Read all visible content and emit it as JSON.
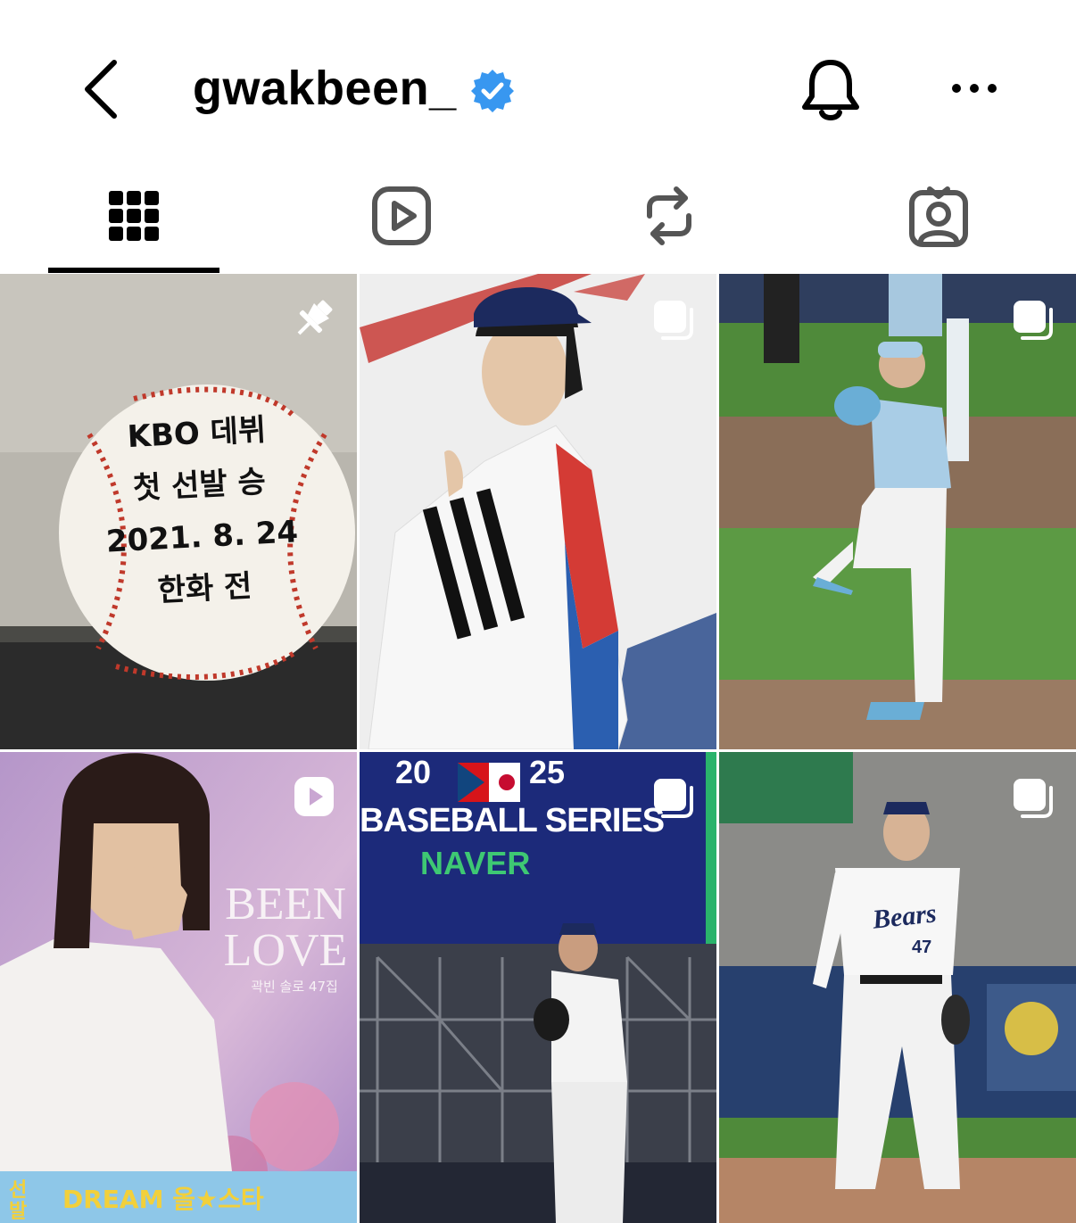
{
  "header": {
    "username": "gwakbeen_",
    "icons": [
      "back-chevron-icon",
      "verified-badge-icon",
      "bell-icon",
      "more-icon"
    ]
  },
  "tabs": [
    {
      "name": "posts-grid-icon",
      "active": true
    },
    {
      "name": "reels-icon",
      "active": false
    },
    {
      "name": "reposts-icon",
      "active": false
    },
    {
      "name": "tagged-icon",
      "active": false
    }
  ],
  "posts": [
    {
      "badge": "pin-icon",
      "ball_lines": [
        "KBO 데뷔",
        "첫 선발 승",
        "2021. 8. 24",
        "한화 전"
      ]
    },
    {
      "badge": "carousel-icon"
    },
    {
      "badge": "carousel-icon"
    },
    {
      "badge": "reel-icon",
      "title_lines": [
        "BEEN",
        "LOVE"
      ],
      "subtitle": "곽빈 솔로 47집",
      "footer": "DREAM 올★스타",
      "side": "선 발"
    },
    {
      "badge": "carousel-icon",
      "year_left": "20",
      "year_right": "25",
      "banner": "BASEBALL SERIES",
      "sponsor": "NAVER"
    },
    {
      "badge": "carousel-icon",
      "jersey": "Bears",
      "number": "47"
    }
  ],
  "colors": {
    "verified": "#3897f0",
    "stitch": "#c0392b",
    "navy": "#1c2a5e",
    "field_green": "#4f8a3a"
  }
}
